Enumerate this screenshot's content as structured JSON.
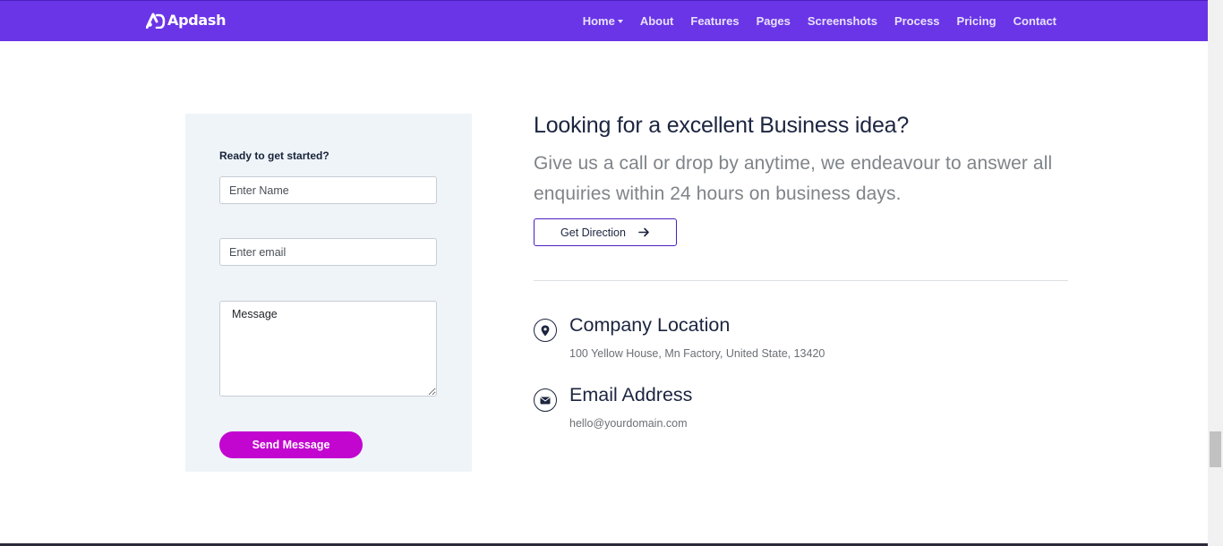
{
  "brand": {
    "name": "Apdash"
  },
  "nav": {
    "items": [
      {
        "label": "Home",
        "has_dropdown": true
      },
      {
        "label": "About"
      },
      {
        "label": "Features"
      },
      {
        "label": "Pages"
      },
      {
        "label": "Screenshots"
      },
      {
        "label": "Process"
      },
      {
        "label": "Pricing"
      },
      {
        "label": "Contact"
      }
    ]
  },
  "form": {
    "heading": "Ready to get started?",
    "name_placeholder": "Enter Name",
    "email_placeholder": "Enter email",
    "message_placeholder": "Message",
    "submit_label": "Send Message"
  },
  "contact": {
    "headline": "Looking for a excellent Business idea?",
    "lead": "Give us a call or drop by anytime, we endeavour to answer all enquiries within 24 hours on business days.",
    "direction_label": "Get Direction",
    "location": {
      "title": "Company Location",
      "text": "100 Yellow House, Mn Factory, United State, 13420",
      "icon": "map-pin-icon"
    },
    "email": {
      "title": "Email Address",
      "text": "hello@yourdomain.com",
      "icon": "envelope-icon"
    }
  },
  "colors": {
    "navbar": "#6a35e6",
    "send_button": "#c206d0",
    "form_background": "#eef4f8",
    "heading_text": "#1c2540"
  }
}
